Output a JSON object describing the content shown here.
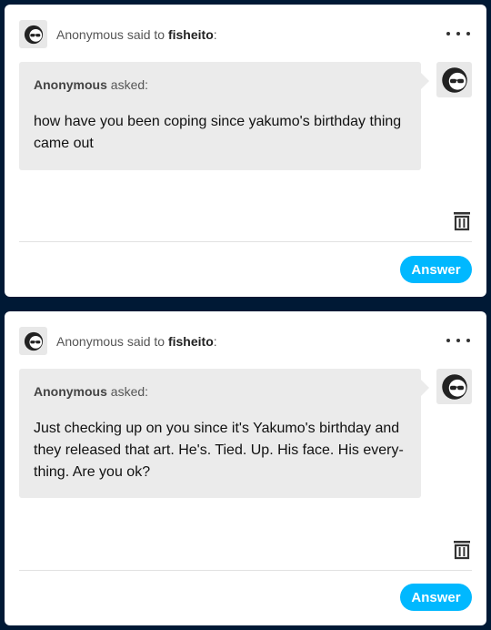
{
  "inbox": {
    "items": [
      {
        "sender": "Anonymous",
        "said_to": " said to ",
        "recipient": "fisheito",
        "colon": ":",
        "asker": "Anonymous",
        "asked": " asked:",
        "question": "how have you been coping since yakumo's birthday thing came out",
        "answer_label": "Answer",
        "avatar_icon": "sunglasses-face-icon",
        "more_icon": "more-dots-icon",
        "delete_icon": "trash-icon"
      },
      {
        "sender": "Anonymous",
        "said_to": " said to ",
        "recipient": "fisheito",
        "colon": ":",
        "asker": "Anonymous",
        "asked": " asked:",
        "question": "Just checking up on you since it's Yakumo's birthday and they released that art. He's. Tied. Up. His face. His every-thing. Are you ok?",
        "answer_label": "Answer",
        "avatar_icon": "sunglasses-face-icon",
        "more_icon": "more-dots-icon",
        "delete_icon": "trash-icon"
      }
    ]
  },
  "colors": {
    "background": "#001935",
    "card": "#ffffff",
    "bubble": "#ebebeb",
    "accent": "#00b8ff"
  }
}
